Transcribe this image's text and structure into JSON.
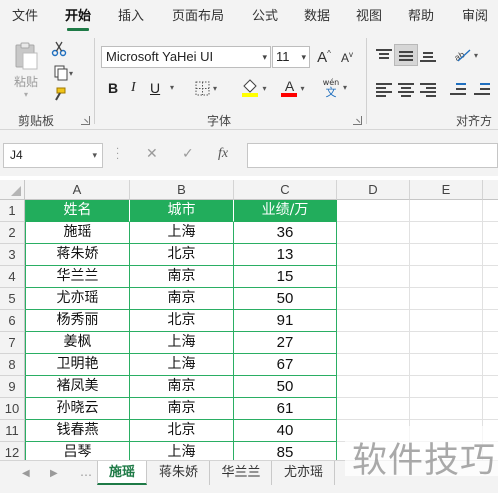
{
  "menu": {
    "tabs": [
      {
        "label": "文件",
        "active": false
      },
      {
        "label": "开始",
        "active": true
      },
      {
        "label": "插入",
        "active": false
      },
      {
        "label": "页面布局",
        "active": false
      },
      {
        "label": "公式",
        "active": false
      },
      {
        "label": "数据",
        "active": false
      },
      {
        "label": "视图",
        "active": false
      },
      {
        "label": "帮助",
        "active": false
      },
      {
        "label": "审阅",
        "active": false
      }
    ]
  },
  "ribbon": {
    "clipboard": {
      "paste_label": "粘贴",
      "group_label": "剪贴板"
    },
    "font": {
      "font_name": "Microsoft YaHei UI",
      "font_size": "11",
      "bold": "B",
      "italic": "I",
      "underline": "U",
      "font_color_letter": "A",
      "phonetic_top": "wén",
      "phonetic_bottom": "文",
      "group_label": "字体",
      "fill_color": "#ffff00",
      "font_color": "#ff0000"
    },
    "alignment": {
      "group_label": "对齐方式"
    }
  },
  "formula_bar": {
    "name_box": "J4",
    "fx_label": "fx",
    "formula": ""
  },
  "sheet": {
    "columns": [
      "A",
      "B",
      "C",
      "D",
      "E"
    ],
    "rows": [
      "1",
      "2",
      "3",
      "4",
      "5",
      "6",
      "7",
      "8",
      "9",
      "10",
      "11",
      "12"
    ],
    "table_header": [
      "姓名",
      "城市",
      "业绩/万"
    ],
    "table_rows": [
      [
        "施瑶",
        "上海",
        "36"
      ],
      [
        "蒋朱娇",
        "北京",
        "13"
      ],
      [
        "华兰兰",
        "南京",
        "15"
      ],
      [
        "尤亦瑶",
        "南京",
        "50"
      ],
      [
        "杨秀丽",
        "北京",
        "91"
      ],
      [
        "姜枫",
        "上海",
        "27"
      ],
      [
        "卫明艳",
        "上海",
        "67"
      ],
      [
        "褚凤美",
        "南京",
        "50"
      ],
      [
        "孙晓云",
        "南京",
        "61"
      ],
      [
        "钱春燕",
        "北京",
        "40"
      ],
      [
        "吕琴",
        "上海",
        "85"
      ]
    ],
    "header_color": "#22ad5c"
  },
  "sheet_tabs": [
    {
      "label": "施瑶",
      "active": true
    },
    {
      "label": "蒋朱娇",
      "active": false
    },
    {
      "label": "华兰兰",
      "active": false
    },
    {
      "label": "尤亦瑶",
      "active": false
    }
  ],
  "watermark": "软件技巧",
  "accent_color": "#1e7a46"
}
